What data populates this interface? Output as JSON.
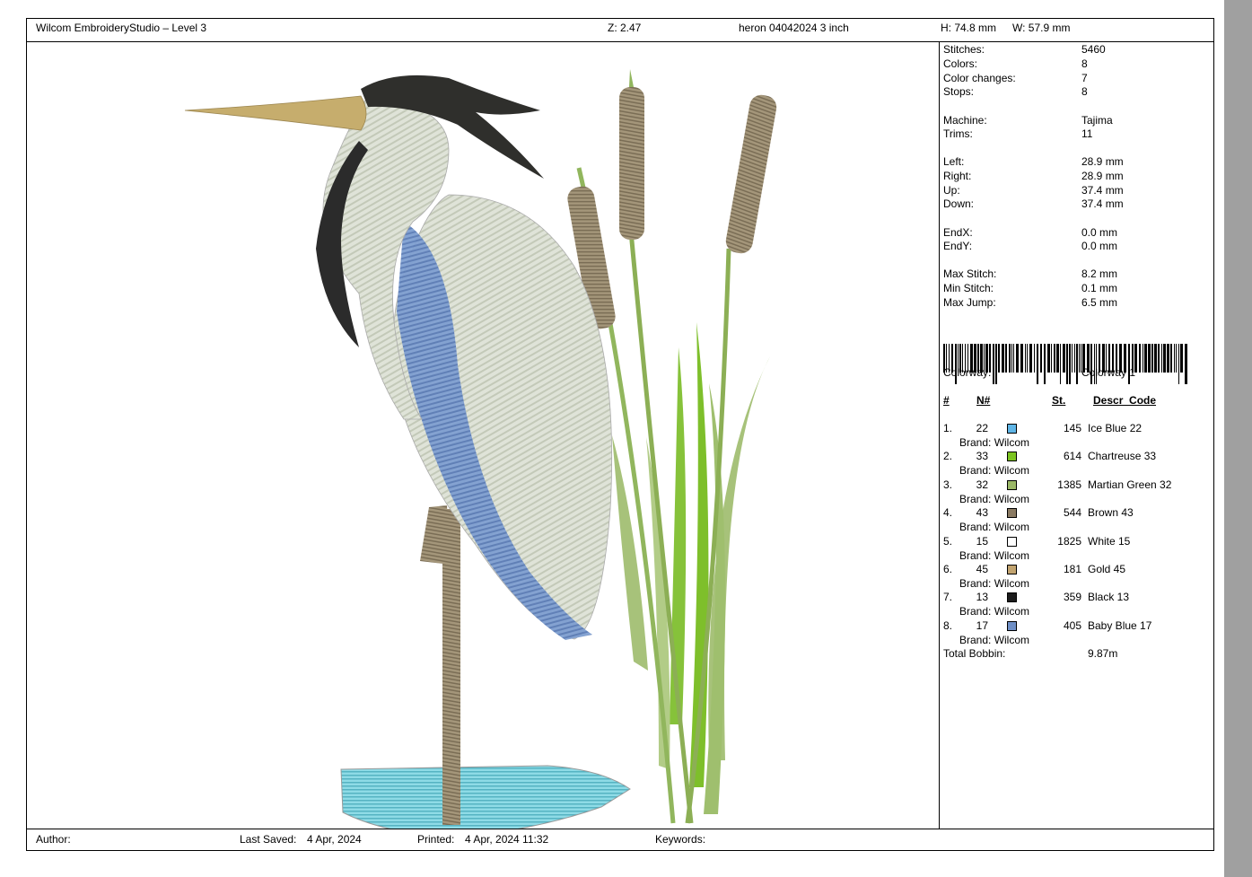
{
  "header": {
    "app_title": "Wilcom EmbroideryStudio – Level 3",
    "zoom": "Z: 2.47",
    "design_name": "heron 04042024 3 inch",
    "height": "H: 74.8 mm",
    "width": "W: 57.9 mm"
  },
  "stats": [
    {
      "label": "Stitches:",
      "value": "5460"
    },
    {
      "label": "Colors:",
      "value": "8"
    },
    {
      "label": "Color changes:",
      "value": "7"
    },
    {
      "label": "Stops:",
      "value": "8"
    },
    {
      "label": "Machine:",
      "value": "Tajima"
    },
    {
      "label": "Trims:",
      "value": "11"
    },
    {
      "label": "Left:",
      "value": "28.9 mm"
    },
    {
      "label": "Right:",
      "value": "28.9 mm"
    },
    {
      "label": "Up:",
      "value": "37.4 mm"
    },
    {
      "label": "Down:",
      "value": "37.4 mm"
    },
    {
      "label": "EndX:",
      "value": "0.0 mm"
    },
    {
      "label": "EndY:",
      "value": "0.0 mm"
    },
    {
      "label": "Max Stitch:",
      "value": "8.2 mm"
    },
    {
      "label": "Min Stitch:",
      "value": "0.1 mm"
    },
    {
      "label": "Max Jump:",
      "value": "6.5 mm"
    }
  ],
  "colorway": {
    "label": "Colorway:",
    "value": "Colorway 1"
  },
  "table": {
    "headers": {
      "index": "#",
      "number": "N#",
      "stitches": "St.",
      "descr": "Descr_Code"
    },
    "rows": [
      {
        "index": "1.",
        "number": "22",
        "color": "#5fb5e6",
        "stitches": "145",
        "descr": "Ice Blue 22",
        "brand": "Brand: Wilcom"
      },
      {
        "index": "2.",
        "number": "33",
        "color": "#7cc421",
        "stitches": "614",
        "descr": "Chartreuse 33",
        "brand": "Brand: Wilcom"
      },
      {
        "index": "3.",
        "number": "32",
        "color": "#9bb867",
        "stitches": "1385",
        "descr": "Martian Green 32",
        "brand": "Brand: Wilcom"
      },
      {
        "index": "4.",
        "number": "43",
        "color": "#8a7a62",
        "stitches": "544",
        "descr": "Brown 43",
        "brand": "Brand: Wilcom"
      },
      {
        "index": "5.",
        "number": "15",
        "color": "#ffffff",
        "stitches": "1825",
        "descr": "White 15",
        "brand": "Brand: Wilcom"
      },
      {
        "index": "6.",
        "number": "45",
        "color": "#c2a470",
        "stitches": "181",
        "descr": "Gold 45",
        "brand": "Brand: Wilcom"
      },
      {
        "index": "7.",
        "number": "13",
        "color": "#1c1c1c",
        "stitches": "359",
        "descr": "Black 13",
        "brand": "Brand: Wilcom"
      },
      {
        "index": "8.",
        "number": "17",
        "color": "#6f8fc6",
        "stitches": "405",
        "descr": "Baby Blue 17",
        "brand": "Brand: Wilcom"
      }
    ]
  },
  "total_bobbin": {
    "label": "Total Bobbin:",
    "value": "9.87m"
  },
  "footer": {
    "author": "Author:",
    "last_saved_label": "Last Saved:",
    "last_saved_value": "4 Apr, 2024",
    "printed_label": "Printed:",
    "printed_value": "4 Apr, 2024 11:32",
    "keywords": "Keywords:"
  },
  "icons": {
    "design_preview": "heron-cattail-embroidery-image",
    "barcode": "barcode-icon"
  }
}
